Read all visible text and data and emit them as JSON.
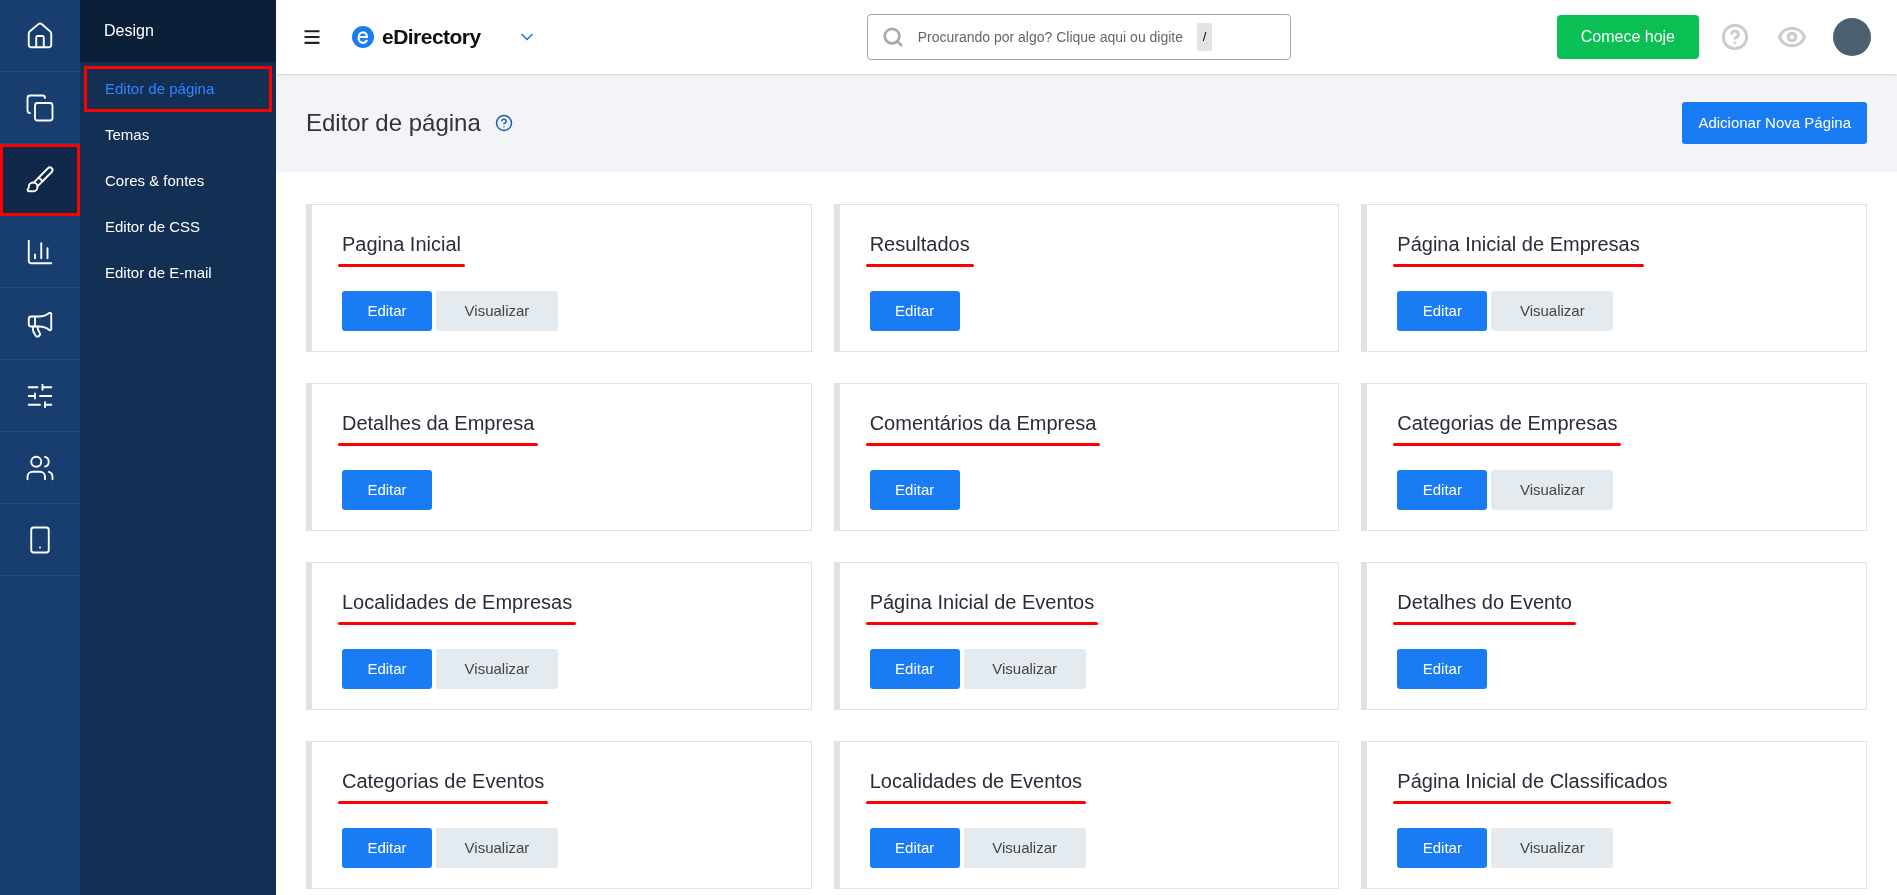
{
  "rail": [
    {
      "selected": false,
      "highlighted": false
    },
    {
      "selected": false,
      "highlighted": false
    },
    {
      "selected": true,
      "highlighted": true
    },
    {
      "selected": false,
      "highlighted": false
    },
    {
      "selected": false,
      "highlighted": false
    },
    {
      "selected": false,
      "highlighted": false
    },
    {
      "selected": false,
      "highlighted": false
    },
    {
      "selected": false,
      "highlighted": false
    }
  ],
  "submenu": {
    "title": "Design",
    "items": [
      {
        "label": "Editor de página",
        "selected": true,
        "highlighted": true
      },
      {
        "label": "Temas",
        "selected": false,
        "highlighted": false
      },
      {
        "label": "Cores & fontes",
        "selected": false,
        "highlighted": false
      },
      {
        "label": "Editor de CSS",
        "selected": false,
        "highlighted": false
      },
      {
        "label": "Editor de E-mail",
        "selected": false,
        "highlighted": false
      }
    ]
  },
  "topbar": {
    "brand": "eDirectory",
    "search": {
      "placeholder": "Procurando por algo? Clique aqui ou digite",
      "shortcut": "/"
    },
    "cta": "Comece hoje"
  },
  "header": {
    "title": "Editor de página",
    "add_button": "Adicionar Nova Página"
  },
  "cards": [
    {
      "title": "Pagina Inicial",
      "underlined": true,
      "buttons": [
        {
          "kind": "edit",
          "label": "Editar"
        },
        {
          "kind": "view",
          "label": "Visualizar"
        }
      ]
    },
    {
      "title": "Resultados",
      "underlined": true,
      "buttons": [
        {
          "kind": "edit",
          "label": "Editar"
        }
      ]
    },
    {
      "title": "Página Inicial de Empresas",
      "underlined": true,
      "buttons": [
        {
          "kind": "edit",
          "label": "Editar"
        },
        {
          "kind": "view",
          "label": "Visualizar"
        }
      ]
    },
    {
      "title": "Detalhes da Empresa",
      "underlined": true,
      "buttons": [
        {
          "kind": "edit",
          "label": "Editar"
        }
      ]
    },
    {
      "title": "Comentários da Empresa",
      "underlined": true,
      "buttons": [
        {
          "kind": "edit",
          "label": "Editar"
        }
      ]
    },
    {
      "title": "Categorias de Empresas",
      "underlined": true,
      "buttons": [
        {
          "kind": "edit",
          "label": "Editar"
        },
        {
          "kind": "view",
          "label": "Visualizar"
        }
      ]
    },
    {
      "title": "Localidades de Empresas",
      "underlined": true,
      "buttons": [
        {
          "kind": "edit",
          "label": "Editar"
        },
        {
          "kind": "view",
          "label": "Visualizar"
        }
      ]
    },
    {
      "title": "Página Inicial de Eventos",
      "underlined": true,
      "buttons": [
        {
          "kind": "edit",
          "label": "Editar"
        },
        {
          "kind": "view",
          "label": "Visualizar"
        }
      ]
    },
    {
      "title": "Detalhes do Evento",
      "underlined": true,
      "buttons": [
        {
          "kind": "edit",
          "label": "Editar"
        }
      ]
    },
    {
      "title": "Categorias de Eventos",
      "underlined": true,
      "buttons": [
        {
          "kind": "edit",
          "label": "Editar"
        },
        {
          "kind": "view",
          "label": "Visualizar"
        }
      ]
    },
    {
      "title": "Localidades de Eventos",
      "underlined": true,
      "buttons": [
        {
          "kind": "edit",
          "label": "Editar"
        },
        {
          "kind": "view",
          "label": "Visualizar"
        }
      ]
    },
    {
      "title": "Página Inicial de Classificados",
      "underlined": true,
      "buttons": [
        {
          "kind": "edit",
          "label": "Editar"
        },
        {
          "kind": "view",
          "label": "Visualizar"
        }
      ]
    }
  ]
}
